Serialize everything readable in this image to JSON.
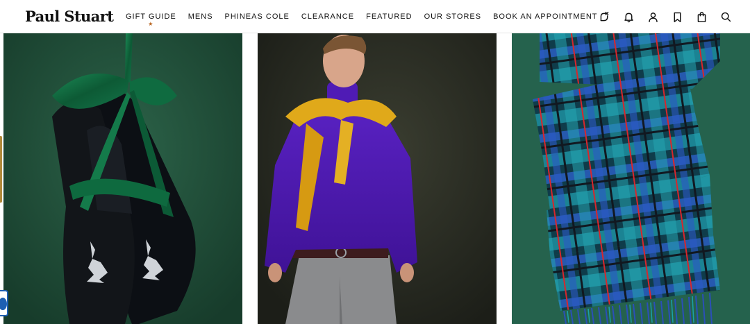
{
  "brand": {
    "logo_text": "Paul Stuart"
  },
  "nav": {
    "items": [
      {
        "label": "GIFT GUIDE",
        "marker": "★"
      },
      {
        "label": "MENS"
      },
      {
        "label": "PHINEAS COLE"
      },
      {
        "label": "CLEARANCE"
      },
      {
        "label": "FEATURED"
      },
      {
        "label": "OUR STORES"
      },
      {
        "label": "BOOK AN APPOINTMENT"
      }
    ]
  },
  "header_icons": [
    "appointment-icon",
    "bell-icon",
    "account-icon",
    "bookmark-icon",
    "bag-icon",
    "search-icon"
  ],
  "tiles": [
    {
      "subject": "velvet-slippers-with-green-ribbon",
      "background": "#1f4a35"
    },
    {
      "subject": "model-purple-turtleneck-yellow-sweater",
      "background": "#262a22"
    },
    {
      "subject": "blue-green-plaid-scarf",
      "background": "#25624d"
    }
  ],
  "colors": {
    "accent_star": "#b8631e",
    "chat_blue": "#1d5fb3"
  }
}
